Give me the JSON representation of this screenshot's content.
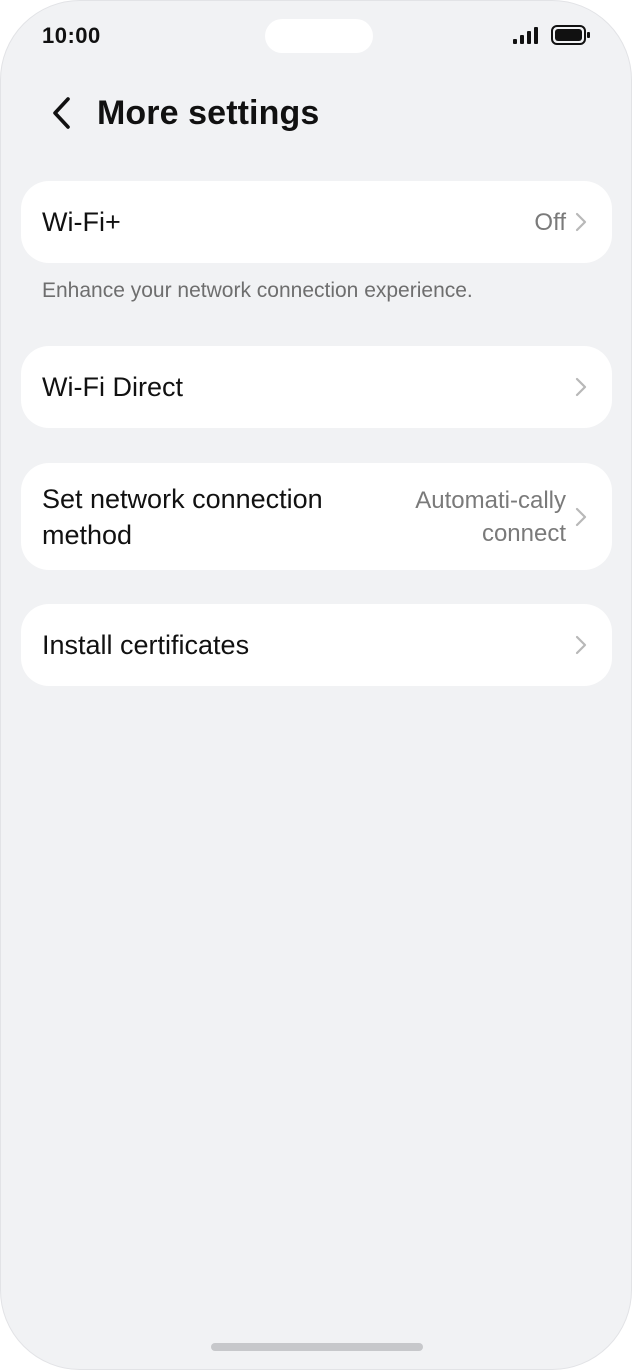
{
  "status_bar": {
    "time": "10:00",
    "signal_icon": "signal-bars-icon",
    "battery_icon": "battery-full-icon"
  },
  "header": {
    "back_icon": "chevron-left-icon",
    "title": "More settings"
  },
  "items": [
    {
      "label": "Wi-Fi+",
      "value": "Off"
    },
    {
      "label": "Wi-Fi Direct",
      "value": ""
    },
    {
      "label": "Set network connection method",
      "value": "Automati-cally connect"
    },
    {
      "label": "Install certificates",
      "value": ""
    }
  ],
  "wifi_plus_caption": "Enhance your network connection experience.",
  "colors": {
    "background": "#f1f2f4",
    "card": "#ffffff",
    "text_primary": "#111111",
    "text_secondary": "#7a7a7a",
    "chevron": "#b8b8b8"
  }
}
